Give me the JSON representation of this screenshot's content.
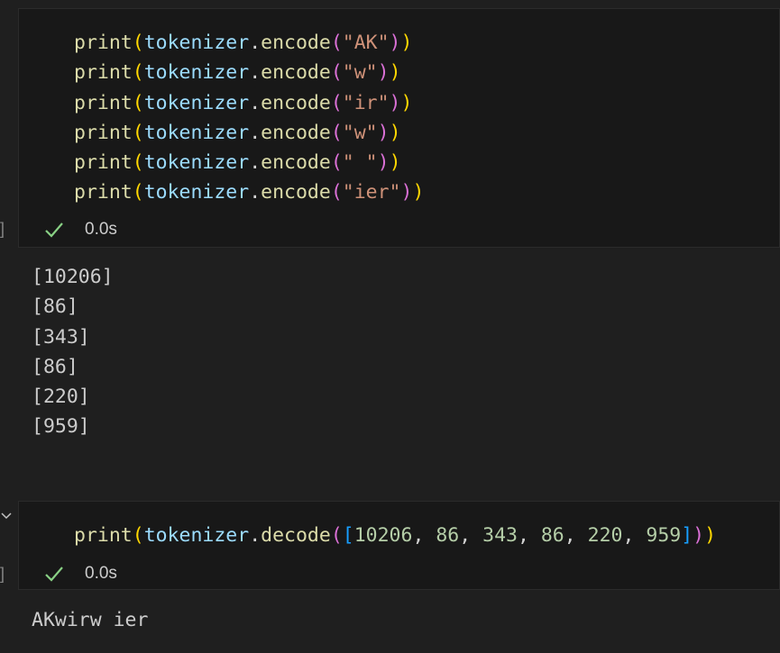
{
  "cell1": {
    "lines": [
      {
        "fn": "print",
        "obj": "tokenizer",
        "method": "encode",
        "arg": "\"AK\""
      },
      {
        "fn": "print",
        "obj": "tokenizer",
        "method": "encode",
        "arg": "\"w\""
      },
      {
        "fn": "print",
        "obj": "tokenizer",
        "method": "encode",
        "arg": "\"ir\""
      },
      {
        "fn": "print",
        "obj": "tokenizer",
        "method": "encode",
        "arg": "\"w\""
      },
      {
        "fn": "print",
        "obj": "tokenizer",
        "method": "encode",
        "arg": "\" \""
      },
      {
        "fn": "print",
        "obj": "tokenizer",
        "method": "encode",
        "arg": "\"ier\""
      }
    ],
    "exec_time": "0.0s",
    "bracket": "]",
    "output": [
      "[10206]",
      "[86]",
      "[343]",
      "[86]",
      "[220]",
      "[959]"
    ]
  },
  "cell2": {
    "fn": "print",
    "obj": "tokenizer",
    "method": "decode",
    "args": [
      "10206",
      "86",
      "343",
      "86",
      "220",
      "959"
    ],
    "exec_time": "0.0s",
    "bracket": "]",
    "output": "AKwirw ier"
  },
  "colors": {
    "function": "#dcdcaa",
    "variable": "#9cdcfe",
    "string": "#ce9178",
    "number": "#b5cea8",
    "bracket_level1": "#ffd700",
    "bracket_level2": "#da70d6",
    "bracket_level3": "#179fff",
    "success": "#89d185"
  },
  "icons": [
    "check-icon",
    "chevron-down-icon"
  ]
}
